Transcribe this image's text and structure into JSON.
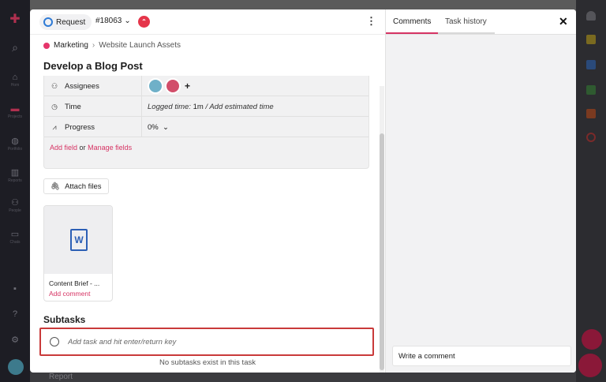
{
  "background": {
    "nav_items": [
      {
        "icon": "plus-icon",
        "glyph": "✚",
        "label": ""
      },
      {
        "icon": "search-icon",
        "glyph": "⌕",
        "label": ""
      },
      {
        "icon": "home-icon",
        "glyph": "⌂",
        "label": "Hom"
      },
      {
        "icon": "folder-icon",
        "glyph": "▬",
        "label": "Projects"
      },
      {
        "icon": "globe-icon",
        "glyph": "◍",
        "label": "Portfolio"
      },
      {
        "icon": "reports-icon",
        "glyph": "▥",
        "label": "Reports"
      },
      {
        "icon": "people-icon",
        "glyph": "⚇",
        "label": "People"
      },
      {
        "icon": "chats-icon",
        "glyph": "▭",
        "label": "Chats"
      },
      {
        "icon": "chat-icon",
        "glyph": "▪",
        "label": ""
      },
      {
        "icon": "help-icon",
        "glyph": "?",
        "label": ""
      },
      {
        "icon": "settings-icon",
        "glyph": "⚙",
        "label": ""
      }
    ],
    "bottom_label": "Report"
  },
  "modal": {
    "type_label": "Request",
    "task_id": "#18063",
    "priority_icon": "priority-icon",
    "breadcrumb": {
      "project": "Marketing",
      "folder": "Website Launch Assets"
    },
    "title": "Develop a Blog Post",
    "fields": [
      {
        "name": "assignees",
        "label": "Assignees",
        "icon": "people-icon"
      },
      {
        "name": "time",
        "label": "Time",
        "icon": "clock-icon",
        "value_prefix": "Logged time:",
        "value_main": "1m",
        "value_suffix": "/ Add estimated time"
      },
      {
        "name": "progress",
        "label": "Progress",
        "icon": "chart-icon",
        "value": "0%"
      }
    ],
    "add_field": "Add field",
    "or_text": "or",
    "manage_fields": "Manage fields",
    "attach_files": "Attach files",
    "file": {
      "name": "Content Brief - ...",
      "comment_link": "Add comment"
    },
    "subtasks_heading": "Subtasks",
    "subtask_placeholder": "Add task and hit enter/return key",
    "no_subtasks": "No subtasks exist in this task"
  },
  "right_panel": {
    "tabs": [
      "Comments",
      "Task history"
    ],
    "active_tab": "Comments",
    "comment_placeholder": "Write a comment"
  },
  "colors": {
    "accent": "#d63464",
    "request_blue": "#2f7bd6",
    "highlight_red": "#c93a3a"
  }
}
